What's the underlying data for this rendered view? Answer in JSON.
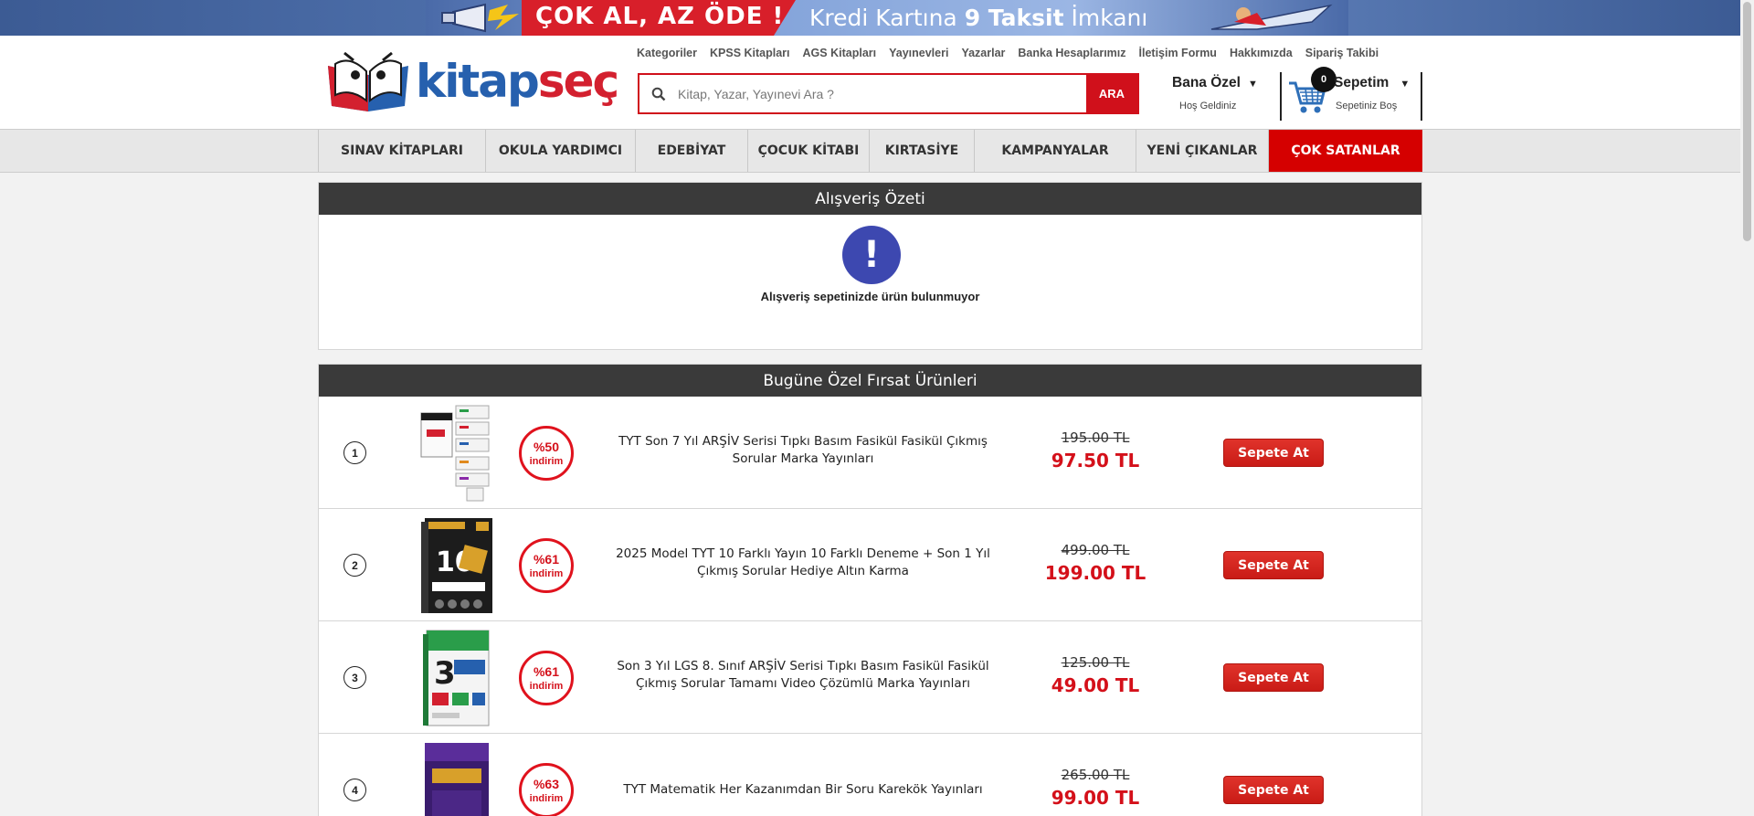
{
  "banner": {
    "left_text": "ÇOK AL, AZ ÖDE !",
    "right_text_prefix": "Kredi Kartına ",
    "right_text_bold": "9 Taksit",
    "right_text_suffix": " İmkanı"
  },
  "logo": {
    "part1": "kitap",
    "part2": "seç"
  },
  "topnav": [
    "Kategoriler",
    "KPSS Kitapları",
    "AGS Kitapları",
    "Yayınevleri",
    "Yazarlar",
    "Banka Hesaplarımız",
    "İletişim Formu",
    "Hakkımızda",
    "Sipariş Takibi"
  ],
  "search": {
    "placeholder": "Kitap, Yazar, Yayınevi Ara ?",
    "button": "ARA"
  },
  "account": {
    "title": "Bana Özel",
    "subtitle": "Hoş Geldiniz",
    "arrow": "▼"
  },
  "cart": {
    "count": "0",
    "title": "Sepetim",
    "subtitle": "Sepetiniz Boş",
    "arrow": "▼"
  },
  "mainnav": [
    "SINAV KİTAPLARI",
    "OKULA YARDIMCI",
    "EDEBİYAT",
    "ÇOCUK KİTABI",
    "KIRTASİYE",
    "KAMPANYALAR",
    "YENİ ÇIKANLAR",
    "ÇOK SATANLAR"
  ],
  "summary": {
    "title": "Alışveriş Özeti",
    "icon": "!",
    "empty_message": "Alışveriş sepetinizde ürün bulunmuyor"
  },
  "deals": {
    "title": "Bugüne Özel Fırsat Ürünleri",
    "discount_label": "indirim",
    "button_label": "Sepete At",
    "items": [
      {
        "rank": "1",
        "discount": "%50",
        "title": "TYT Son 7 Yıl ARŞİV Serisi Tıpkı Basım Fasikül Fasikül Çıkmış Sorular Marka Yayınları",
        "old_price": "195.00 TL",
        "new_price": "97.50 TL"
      },
      {
        "rank": "2",
        "discount": "%61",
        "title": "2025 Model TYT 10 Farklı Yayın 10 Farklı Deneme + Son 1 Yıl Çıkmış Sorular Hediye Altın Karma",
        "old_price": "499.00 TL",
        "new_price": "199.00 TL"
      },
      {
        "rank": "3",
        "discount": "%61",
        "title": "Son 3 Yıl LGS 8. Sınıf ARŞİV Serisi Tıpkı Basım Fasikül Fasikül Çıkmış Sorular Tamamı Video Çözümlü Marka Yayınları",
        "old_price": "125.00 TL",
        "new_price": "49.00 TL"
      },
      {
        "rank": "4",
        "discount": "%63",
        "title": "TYT Matematik Her Kazanımdan Bir Soru Karekök Yayınları",
        "old_price": "265.00 TL",
        "new_price": "99.00 TL"
      }
    ]
  },
  "colors": {
    "brand_red": "#d0101b",
    "brand_blue": "#2660ae",
    "dark_header": "#3a3a3a",
    "empty_icon": "#3d48b0"
  }
}
